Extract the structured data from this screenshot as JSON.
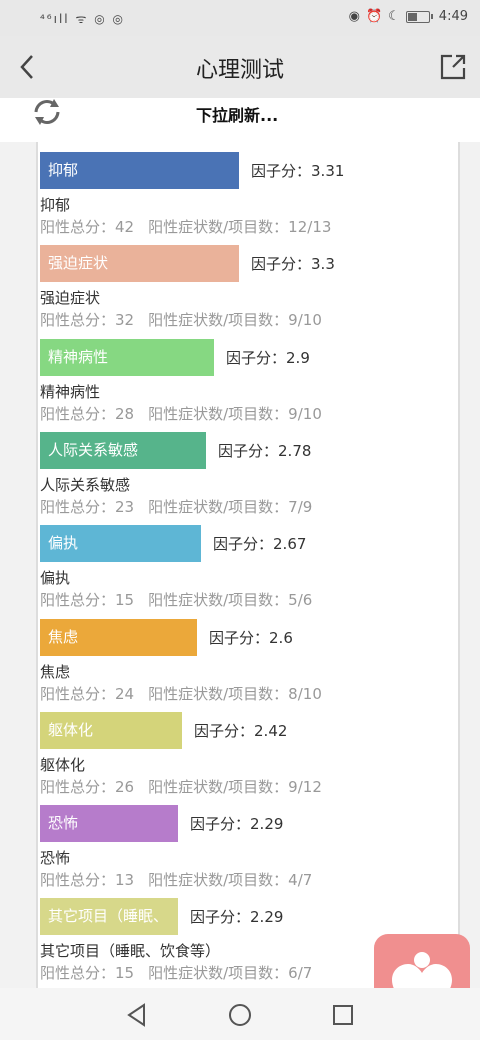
{
  "status_bar": {
    "left_icons": "⁴⁶ıll ᯤ ◎ ◎",
    "time": "4:49"
  },
  "header": {
    "title": "心理测试"
  },
  "refresh": {
    "text": "下拉刷新..."
  },
  "score_prefix": "因子分：",
  "positive_total_label": "阳性总分：",
  "symptom_ratio_label": "阳性症状数/项目数：",
  "factors": [
    {
      "bar_label": "抑郁",
      "score": "3.31",
      "name": "抑郁",
      "positive_total": "42",
      "ratio": "12/13",
      "color": "#4a73b5",
      "bar_fraction": 0.4738
    },
    {
      "bar_label": "强迫症状",
      "score": "3.3",
      "name": "强迫症状",
      "positive_total": "32",
      "ratio": "9/10",
      "color": "#eab29a",
      "bar_fraction": 0.4738
    },
    {
      "bar_label": "精神病性",
      "score": "2.9",
      "name": "精神病性",
      "positive_total": "28",
      "ratio": "9/10",
      "color": "#86d882",
      "bar_fraction": 0.4143
    },
    {
      "bar_label": "人际关系敏感",
      "score": "2.78",
      "name": "人际关系敏感",
      "positive_total": "23",
      "ratio": "7/9",
      "color": "#56b48b",
      "bar_fraction": 0.3952
    },
    {
      "bar_label": "偏执",
      "score": "2.67",
      "name": "偏执",
      "positive_total": "15",
      "ratio": "5/6",
      "color": "#5eb6d5",
      "bar_fraction": 0.3833
    },
    {
      "bar_label": "焦虑",
      "score": "2.6",
      "name": "焦虑",
      "positive_total": "24",
      "ratio": "8/10",
      "color": "#eba83a",
      "bar_fraction": 0.3738
    },
    {
      "bar_label": "躯体化",
      "score": "2.42",
      "name": "躯体化",
      "positive_total": "26",
      "ratio": "9/12",
      "color": "#d4d47a",
      "bar_fraction": 0.3381
    },
    {
      "bar_label": "恐怖",
      "score": "2.29",
      "name": "恐怖",
      "positive_total": "13",
      "ratio": "4/7",
      "color": "#b67ccb",
      "bar_fraction": 0.3286
    },
    {
      "bar_label": "其它项目（睡眠、",
      "score": "2.29",
      "name": "其它项目（睡眠、饮食等）",
      "positive_total": "15",
      "ratio": "6/7",
      "color": "#d7d88a",
      "bar_fraction": 0.3286
    }
  ],
  "icons": {
    "back": "back-arrow-icon",
    "share": "share-icon",
    "refresh": "refresh-icon",
    "nav_back": "triangle-back-icon",
    "nav_home": "circle-home-icon",
    "nav_recent": "square-recent-icon",
    "fab": "heart-person-icon"
  }
}
